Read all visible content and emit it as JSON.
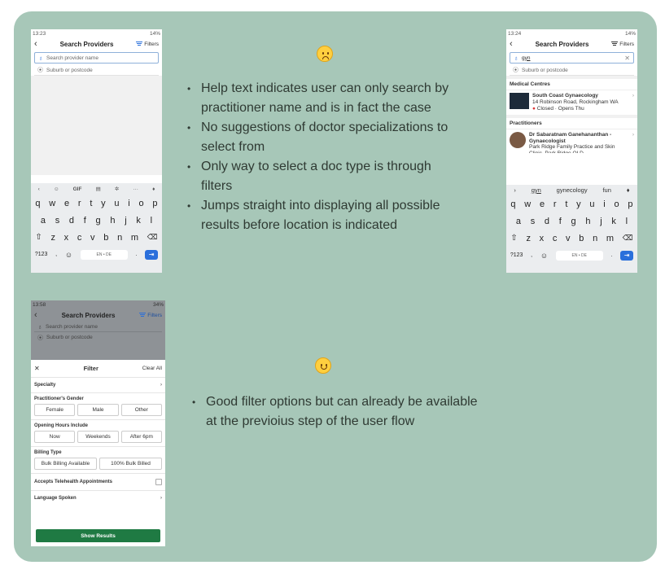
{
  "phone1": {
    "status": {
      "time": "13:23",
      "right": "14%"
    },
    "title": "Search Providers",
    "filters": "Filters",
    "search_placeholder": "Search provider name",
    "suburb_placeholder": "Suburb or postcode",
    "kbd_tools": {
      "gif": "GIF",
      "more": "···"
    },
    "keys_row1": [
      "q",
      "w",
      "e",
      "r",
      "t",
      "y",
      "u",
      "i",
      "o",
      "p"
    ],
    "keys_row2": [
      "a",
      "s",
      "d",
      "f",
      "g",
      "h",
      "j",
      "k",
      "l"
    ],
    "keys_row3": [
      "z",
      "x",
      "c",
      "v",
      "b",
      "n",
      "m"
    ],
    "bottom": {
      "sym": "?123",
      "comma": ",",
      "space": "EN • DE",
      "period": "."
    }
  },
  "phone2": {
    "status": {
      "time": "13:24",
      "right": "14%"
    },
    "title": "Search Providers",
    "filters": "Filters",
    "search_value": "gyn",
    "suburb_placeholder": "Suburb or postcode",
    "section_medical": "Medical Centres",
    "medical": {
      "name": "South Coast Gynaecology",
      "address": "14 Robinson Road, Rockingham WA",
      "status": "Closed · Opens Thu",
      "logo": "SOUTH COAST GYNAECOLOGY"
    },
    "section_practitioners": "Practitioners",
    "practitioner": {
      "name": "Dr Sabaratnam Ganehananthan - Gynaecologist",
      "practice": "Park Ridge Family Practice and Skin Clinic, Park Ridge QLD"
    },
    "suggestions": [
      "gyn",
      "gynecology",
      "fun"
    ],
    "keys_row1": [
      "q",
      "w",
      "e",
      "r",
      "t",
      "y",
      "u",
      "i",
      "o",
      "p"
    ],
    "keys_row2": [
      "a",
      "s",
      "d",
      "f",
      "g",
      "h",
      "j",
      "k",
      "l"
    ],
    "keys_row3": [
      "z",
      "x",
      "c",
      "v",
      "b",
      "n",
      "m"
    ],
    "bottom": {
      "sym": "?123",
      "comma": ",",
      "space": "EN • DE",
      "period": "."
    }
  },
  "phone3": {
    "status": {
      "time": "13:58",
      "right": "34%"
    },
    "title": "Search Providers",
    "filters": "Filters",
    "search_placeholder": "Search provider name",
    "suburb_placeholder": "Suburb or postcode",
    "sheet_title": "Filter",
    "clear_all": "Clear All",
    "specialty": "Specialty",
    "gender_label": "Practitioner's Gender",
    "gender": [
      "Female",
      "Male",
      "Other"
    ],
    "hours_label": "Opening Hours Include",
    "hours": [
      "Now",
      "Weekends",
      "After 6pm"
    ],
    "billing_label": "Billing Type",
    "billing": [
      "Bulk Billing Available",
      "100% Bulk Billed"
    ],
    "telehealth": "Accepts Telehealth Appointments",
    "language": "Language Spoken",
    "show_results": "Show Results"
  },
  "notes_top": [
    "Help text indicates user can only search by practitioner name and is in fact the case",
    "No suggestions of doctor specializations to select from",
    "Only way to select a doc type is through filters",
    "Jumps straight into displaying all possible results before location is indicated"
  ],
  "notes_bottom": [
    "Good filter options but can already be available at the previoius step of the user flow"
  ],
  "colors": {
    "board": "#a7c7b8",
    "accent": "#2a6fdb",
    "show_btn": "#1f7a43",
    "emoji": "#ffcf3f"
  },
  "icons": {
    "sad": "frowning-face-icon",
    "happy": "smiling-face-icon"
  }
}
